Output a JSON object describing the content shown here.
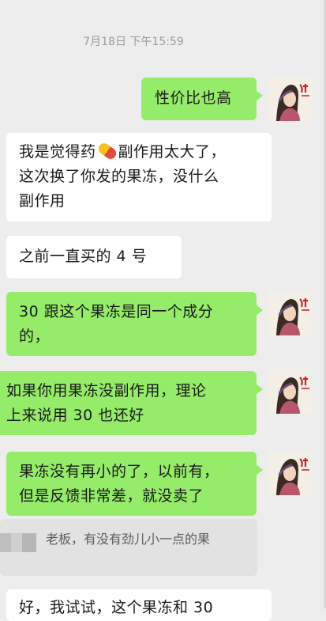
{
  "timestamp": "7月18日 下午15:59",
  "messages": [
    {
      "text": "性价比也高"
    },
    {
      "line1_a": "我是觉得药",
      "line1_b": "副作用太大了，",
      "line2": "这次换了你发的果冻，没什么",
      "line3": "副作用",
      "emoji": "pill-emoji"
    },
    {
      "text": "之前一直买的 4 号"
    },
    {
      "line1": "30 跟这个果冻是同一个成分",
      "line2": "的，"
    },
    {
      "line1": "如果你用果冻没副作用，理论",
      "line2": "上来说用 30 也还好"
    },
    {
      "line1": "果冻没有再小的了，以前有，",
      "line2": "但是反馈非常差，就没卖了"
    }
  ],
  "quote": {
    "text": "老板，有没有劲儿小一点的果"
  },
  "partial_bottom": {
    "text": "好，我试试，这个果冻和 30"
  },
  "colors": {
    "outgoing": "#95ec69",
    "incoming": "#ffffff",
    "background": "#ededed"
  }
}
